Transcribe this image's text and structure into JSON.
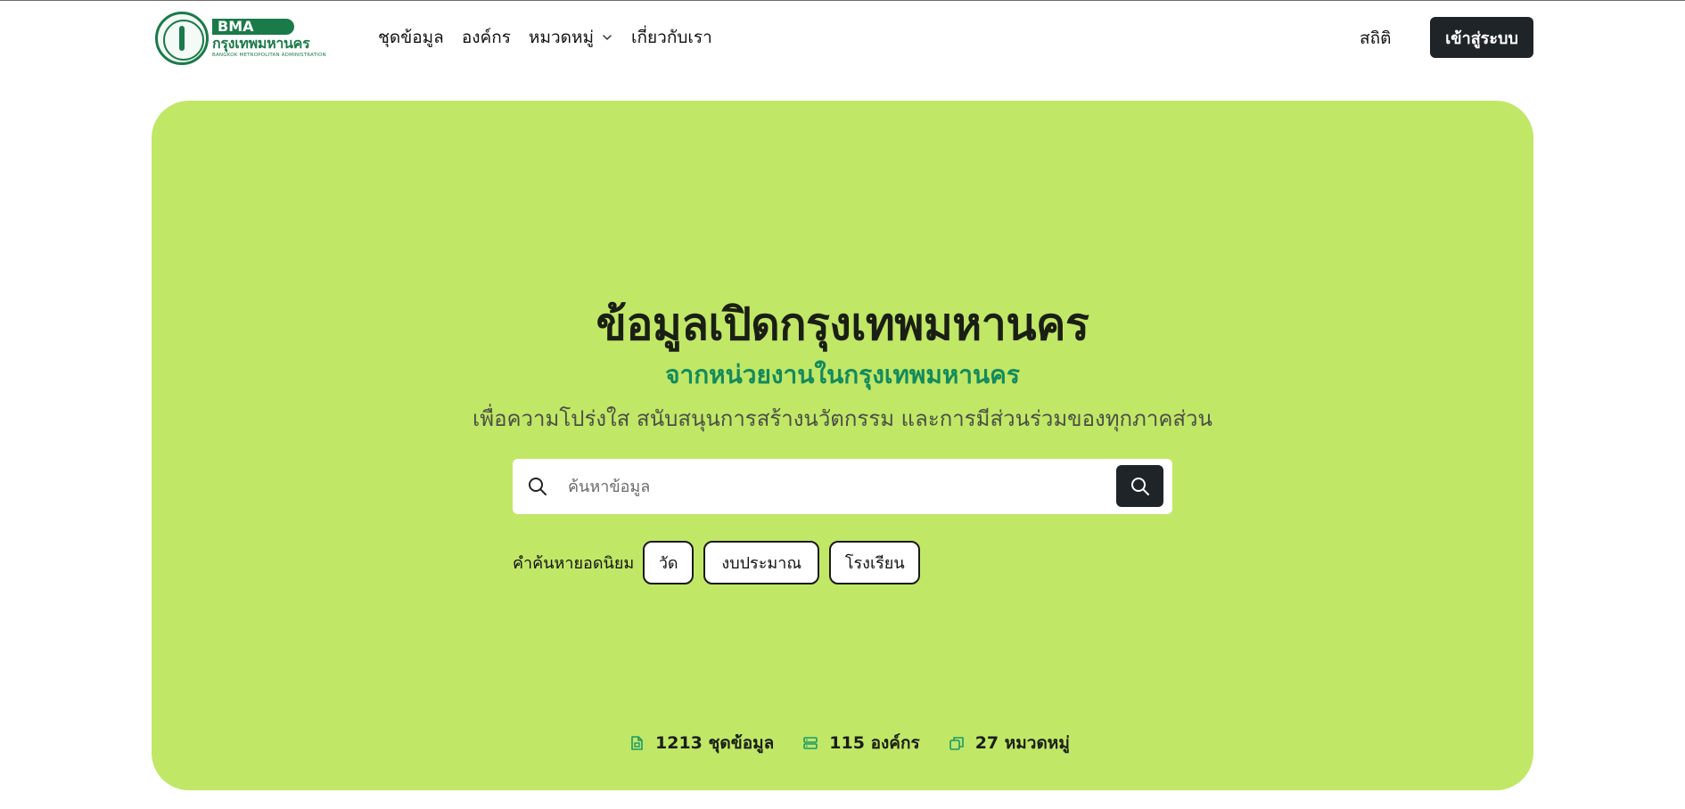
{
  "brand": {
    "bma_label": "BMA",
    "name_th": "กรุงเทพมหานคร",
    "name_en": "BANGKOK METROPOLITAN ADMINISTRATION"
  },
  "nav": {
    "items": [
      {
        "label": "ชุดข้อมูล"
      },
      {
        "label": "องค์กร"
      },
      {
        "label": "หมวดหมู่"
      },
      {
        "label": "เกี่ยวกับเรา"
      }
    ],
    "stats_label": "สถิติ",
    "login_label": "เข้าสู่ระบบ"
  },
  "hero": {
    "title": "ข้อมูลเปิดกรุงเทพมหานคร",
    "subtitle": "จากหน่วยงานในกรุงเทพมหานคร",
    "description": "เพื่อความโปร่งใส สนับสนุนการสร้างนวัตกรรม และการมีส่วนร่วมของทุกภาคส่วน"
  },
  "search": {
    "placeholder": "ค้นหาข้อมูล",
    "value": ""
  },
  "popular": {
    "label": "คำค้นหายอดนิยม",
    "terms": [
      "วัด",
      "งบประมาณ",
      "โรงเรียน"
    ]
  },
  "counts": [
    {
      "icon": "dataset-icon",
      "text": "1213 ชุดข้อมูล"
    },
    {
      "icon": "organization-icon",
      "text": "115 องค์กร"
    },
    {
      "icon": "category-icon",
      "text": "27 หมวดหมู่"
    }
  ],
  "colors": {
    "hero_bg": "#c1e767",
    "brand_green": "#1b7a4a",
    "subtitle_green": "#138a5c",
    "dark_button": "#1f2429"
  }
}
